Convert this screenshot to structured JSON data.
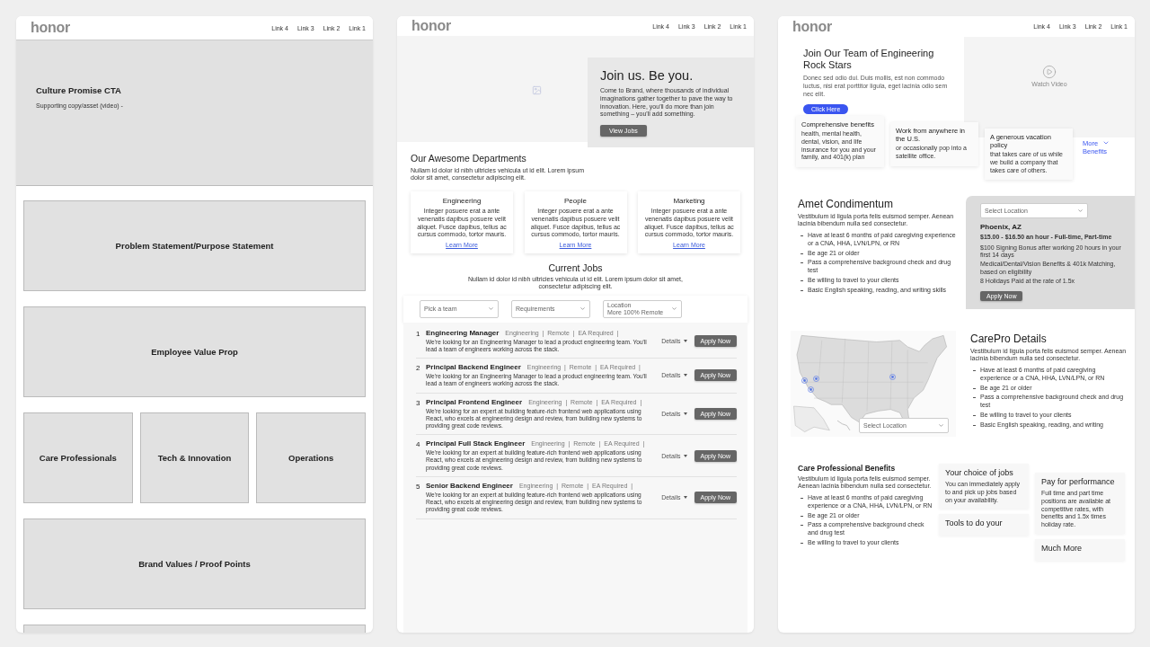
{
  "culture_page": {
    "nav": {
      "logo": "honor",
      "links": [
        "Link 4",
        "Link 3",
        "Link 2",
        "Link 1"
      ]
    },
    "hero": {
      "title": "Culture Promise CTA",
      "subtitle": "Supporting copy/asset (video) -"
    },
    "blocks": [
      {
        "kind": "wide",
        "title": "Problem Statement/Purpose Statement"
      },
      {
        "kind": "wide",
        "title": "Employee Value Prop"
      },
      {
        "kind": "trio",
        "titles": [
          "Care Professionals",
          "Tech & Innovation",
          "Operations"
        ]
      },
      {
        "kind": "wide",
        "title": "Brand Values / Proof Points"
      },
      {
        "kind": "wide"
      }
    ]
  },
  "careers_page": {
    "nav": {
      "logo": "honor",
      "links": [
        "Link 4",
        "Link 3",
        "Link 2",
        "Link 1"
      ]
    },
    "hero": {
      "title": "Join us. Be you.",
      "text": "Come to Brand, where thousands of individual imaginations gather together to pave the way to innovation. Here, you'll do more than join something – you'll add something.",
      "button": "View Jobs"
    },
    "departments": {
      "title": "Our Awesome Departments",
      "text": "Nullam id dolor id nibh ultricies vehicula ut id elit. Lorem ipsum dolor sit amet, consectetur adipiscing elit.",
      "cards": [
        {
          "title": "Engineering",
          "text": "Integer posuere erat a ante venenatis dapibus posuere velit aliquet. Fusce dapibus, tellus ac cursus commodo, tortor mauris.",
          "link": "Learn More"
        },
        {
          "title": "People",
          "text": "Integer posuere erat a ante venenatis dapibus posuere velit aliquet. Fusce dapibus, tellus ac cursus commodo, tortor mauris.",
          "link": "Learn More"
        },
        {
          "title": "Marketing",
          "text": "Integer posuere erat a ante venenatis dapibus posuere velit aliquet. Fusce dapibus, tellus ac cursus commodo, tortor mauris.",
          "link": "Learn More"
        }
      ]
    },
    "jobs": {
      "title": "Current Jobs",
      "text": "Nullam id dolor id nibh ultricies vehicula ut id elit. Lorem ipsum dolor sit amet, consectetur adipiscing elit.",
      "filters": [
        {
          "placeholder": "Pick a team"
        },
        {
          "placeholder": "Requirements"
        },
        {
          "label": "Location",
          "value": "More 100% Remote"
        }
      ],
      "rows": [
        {
          "number": "1",
          "title": "Engineering Manager",
          "tags": "Engineering  |  Remote  |  EA Required  |",
          "text": "We're looking for an Engineering Manager to lead a product engineering team.  You'll lead a team of engineers working across the stack.",
          "details": "Details",
          "button": "Apply Now"
        },
        {
          "number": "2",
          "title": "Principal Backend Engineer",
          "tags": "Engineering  |  Remote  |  EA Required  |",
          "text": "We're looking for an Engineering Manager to lead a product engineering team.  You'll lead a team of engineers working across the stack.",
          "details": "Details",
          "button": "Apply Now"
        },
        {
          "number": "3",
          "title": "Principal Frontend Engineer",
          "tags": "Engineering  |  Remote  |  EA Required  |",
          "text": "We're looking for an expert at building feature-rich frontend web applications using React, who excels at engineering design and review, from building new systems to providing great code reviews.",
          "details": "Details",
          "button": "Apply Now"
        },
        {
          "number": "4",
          "title": "Principal Full Stack Engineer",
          "tags": "Engineering  |  Remote  |  EA Required  |",
          "text": "We're looking for an expert at building feature-rich frontend web applications using React, who excels at engineering design and review, from building new systems to providing great code reviews.",
          "details": "Details",
          "button": "Apply Now"
        },
        {
          "number": "5",
          "title": "Senior Backend Engineer",
          "tags": "Engineering  |  Remote  |  EA Required  |",
          "text": "We're looking for an expert at building feature-rich frontend web applications using React, who excels at engineering design and review, from building new systems to providing great code reviews.",
          "details": "Details",
          "button": "Apply Now"
        }
      ]
    }
  },
  "carepro_page": {
    "nav": {
      "logo": "honor",
      "links": [
        "Link 4",
        "Link 3",
        "Link 2",
        "Link 1"
      ]
    },
    "hero": {
      "title": "Join Our Team of Engineering Rock Stars",
      "text": "Donec sed odio dui. Duis mollis, est non commodo luctus, nisi erat porttitor ligula, eget lacinia odio sem nec elit.",
      "button": "Click Here",
      "video_label": "Watch Video"
    },
    "benefits": [
      {
        "title": "Comprehensive benefits",
        "text": "health, mental health, dental, vision, and life insurance for you and your family, and 401(k) plan"
      },
      {
        "title": "Work from anywhere in the U.S.",
        "text": "or occasionally pop into a satellite office."
      },
      {
        "title": "A generous vacation policy",
        "text": "that takes care of us while we build a company that takes care of others."
      }
    ],
    "more_link": "More Benefits",
    "requirements": {
      "title": "Amet Condimentum",
      "text": "Vestibulum id ligula porta felis euismod semper. Aenean lacinia bibendum nulla sed consectetur.",
      "bullets": [
        "Have at least 6 months of paid caregiving experience or a CNA, HHA, LVN/LPN, or RN",
        "Be age 21 or older",
        "Pass a comprehensive background check and drug test",
        "Be willing to travel to your clients",
        "Basic English speaking, reading, and writing skills"
      ]
    },
    "location": {
      "placeholder": "Select Location",
      "city": "Phoenix, AZ",
      "pay": "$15.00 - $16.50 an hour - Full-time, Part-time",
      "perks": [
        "$100 Signing Bonus after working 20 hours in your first 14 days",
        "Medical/Dental/Vision Benefits & 401k Matching, based on eligibility",
        "8 Holidays Paid at the rate of 1.5x"
      ],
      "button": "Apply Now"
    },
    "map": {
      "placeholder": "Select Location"
    },
    "details": {
      "title": "CarePro Details",
      "text": "Vestibulum id ligula porta felis euismod semper. Aenean lacinia bibendum nulla sed consectetur.",
      "bullets": [
        "Have at least 6 months of paid caregiving experience or a CNA, HHA, LVN/LPN, or RN",
        "Be age 21 or older",
        "Pass a comprehensive background check and drug test",
        "Be willing to travel to your clients",
        "Basic English speaking, reading, and writing"
      ]
    },
    "care_benefits": {
      "title": "Care Professional Benefits",
      "text": "Vestibulum id ligula porta felis euismod semper. Aenean lacinia bibendum nulla sed consectetur.",
      "bullets": [
        "Have at least 6 months of paid caregiving experience or a CNA, HHA, LVN/LPN, or RN",
        "Be age 21 or older",
        "Pass a comprehensive background check and drug test",
        "Be willing to travel to your clients"
      ],
      "card_columns": [
        {
          "cards": [
            {
              "title": "Your choice of jobs",
              "text": "You can immediately apply to and pick up jobs based on your availability."
            },
            {
              "title": "Tools to do your"
            }
          ]
        },
        {
          "cards": [
            {
              "title": "Pay for performance",
              "text": "Full time and part time positions are available at competitive rates, with benefits and 1.5x times holiday rate."
            },
            {
              "title": "Much More"
            }
          ]
        }
      ]
    }
  }
}
